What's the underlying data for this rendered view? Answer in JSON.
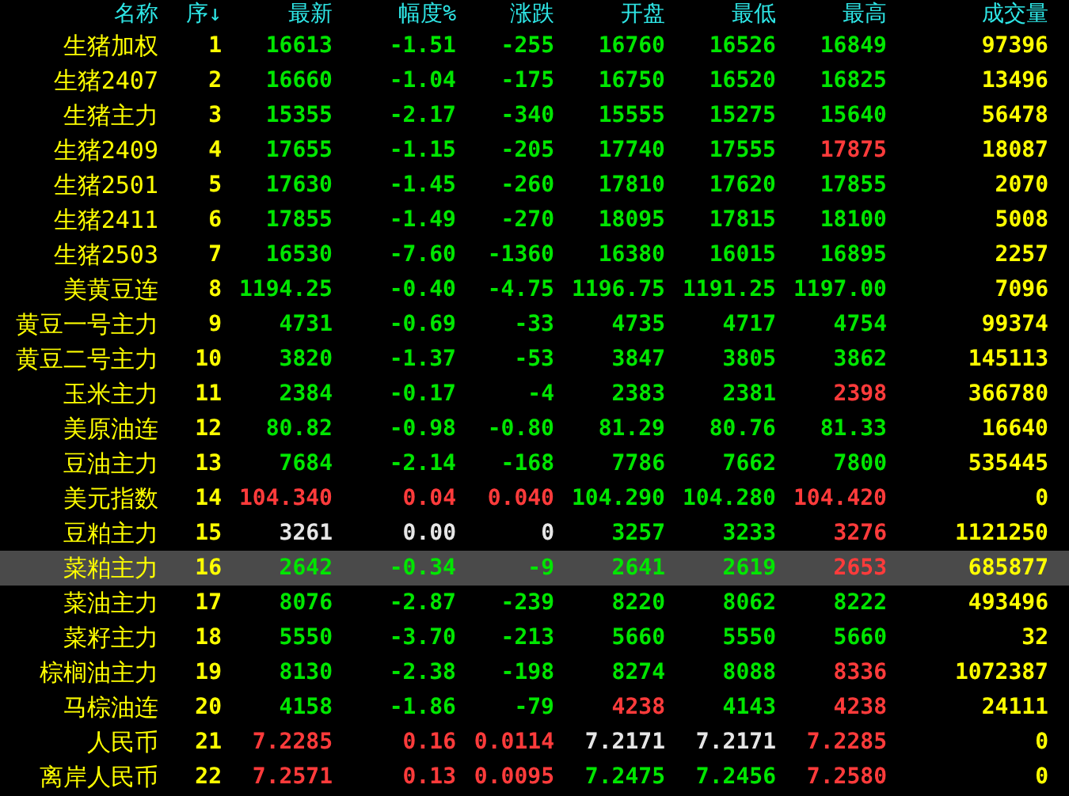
{
  "columns": [
    "名称",
    "序↓",
    "最新",
    "幅度%",
    "涨跌",
    "开盘",
    "最低",
    "最高",
    "成交量"
  ],
  "rows": [
    {
      "name": "生猪加权",
      "index": "1",
      "selected": false,
      "cells": [
        {
          "text": "16613",
          "color": "#00e600"
        },
        {
          "text": "-1.51",
          "color": "#00e600"
        },
        {
          "text": "-255",
          "color": "#00e600"
        },
        {
          "text": "16760",
          "color": "#00e600"
        },
        {
          "text": "16526",
          "color": "#00e600"
        },
        {
          "text": "16849",
          "color": "#00e600"
        }
      ],
      "volume": "97396"
    },
    {
      "name": "生猪2407",
      "index": "2",
      "selected": false,
      "cells": [
        {
          "text": "16660",
          "color": "#00e600"
        },
        {
          "text": "-1.04",
          "color": "#00e600"
        },
        {
          "text": "-175",
          "color": "#00e600"
        },
        {
          "text": "16750",
          "color": "#00e600"
        },
        {
          "text": "16520",
          "color": "#00e600"
        },
        {
          "text": "16825",
          "color": "#00e600"
        }
      ],
      "volume": "13496"
    },
    {
      "name": "生猪主力",
      "index": "3",
      "selected": false,
      "cells": [
        {
          "text": "15355",
          "color": "#00e600"
        },
        {
          "text": "-2.17",
          "color": "#00e600"
        },
        {
          "text": "-340",
          "color": "#00e600"
        },
        {
          "text": "15555",
          "color": "#00e600"
        },
        {
          "text": "15275",
          "color": "#00e600"
        },
        {
          "text": "15640",
          "color": "#00e600"
        }
      ],
      "volume": "56478"
    },
    {
      "name": "生猪2409",
      "index": "4",
      "selected": false,
      "cells": [
        {
          "text": "17655",
          "color": "#00e600"
        },
        {
          "text": "-1.15",
          "color": "#00e600"
        },
        {
          "text": "-205",
          "color": "#00e600"
        },
        {
          "text": "17740",
          "color": "#00e600"
        },
        {
          "text": "17555",
          "color": "#00e600"
        },
        {
          "text": "17875",
          "color": "#ff3b3b"
        }
      ],
      "volume": "18087"
    },
    {
      "name": "生猪2501",
      "index": "5",
      "selected": false,
      "cells": [
        {
          "text": "17630",
          "color": "#00e600"
        },
        {
          "text": "-1.45",
          "color": "#00e600"
        },
        {
          "text": "-260",
          "color": "#00e600"
        },
        {
          "text": "17810",
          "color": "#00e600"
        },
        {
          "text": "17620",
          "color": "#00e600"
        },
        {
          "text": "17855",
          "color": "#00e600"
        }
      ],
      "volume": "2070"
    },
    {
      "name": "生猪2411",
      "index": "6",
      "selected": false,
      "cells": [
        {
          "text": "17855",
          "color": "#00e600"
        },
        {
          "text": "-1.49",
          "color": "#00e600"
        },
        {
          "text": "-270",
          "color": "#00e600"
        },
        {
          "text": "18095",
          "color": "#00e600"
        },
        {
          "text": "17815",
          "color": "#00e600"
        },
        {
          "text": "18100",
          "color": "#00e600"
        }
      ],
      "volume": "5008"
    },
    {
      "name": "生猪2503",
      "index": "7",
      "selected": false,
      "cells": [
        {
          "text": "16530",
          "color": "#00e600"
        },
        {
          "text": "-7.60",
          "color": "#00e600"
        },
        {
          "text": "-1360",
          "color": "#00e600"
        },
        {
          "text": "16380",
          "color": "#00e600"
        },
        {
          "text": "16015",
          "color": "#00e600"
        },
        {
          "text": "16895",
          "color": "#00e600"
        }
      ],
      "volume": "2257"
    },
    {
      "name": "美黄豆连",
      "index": "8",
      "selected": false,
      "cells": [
        {
          "text": "1194.25",
          "color": "#00e600"
        },
        {
          "text": "-0.40",
          "color": "#00e600"
        },
        {
          "text": "-4.75",
          "color": "#00e600"
        },
        {
          "text": "1196.75",
          "color": "#00e600"
        },
        {
          "text": "1191.25",
          "color": "#00e600"
        },
        {
          "text": "1197.00",
          "color": "#00e600"
        }
      ],
      "volume": "7096"
    },
    {
      "name": "黄豆一号主力",
      "index": "9",
      "selected": false,
      "cells": [
        {
          "text": "4731",
          "color": "#00e600"
        },
        {
          "text": "-0.69",
          "color": "#00e600"
        },
        {
          "text": "-33",
          "color": "#00e600"
        },
        {
          "text": "4735",
          "color": "#00e600"
        },
        {
          "text": "4717",
          "color": "#00e600"
        },
        {
          "text": "4754",
          "color": "#00e600"
        }
      ],
      "volume": "99374"
    },
    {
      "name": "黄豆二号主力",
      "index": "10",
      "selected": false,
      "cells": [
        {
          "text": "3820",
          "color": "#00e600"
        },
        {
          "text": "-1.37",
          "color": "#00e600"
        },
        {
          "text": "-53",
          "color": "#00e600"
        },
        {
          "text": "3847",
          "color": "#00e600"
        },
        {
          "text": "3805",
          "color": "#00e600"
        },
        {
          "text": "3862",
          "color": "#00e600"
        }
      ],
      "volume": "145113"
    },
    {
      "name": "玉米主力",
      "index": "11",
      "selected": false,
      "cells": [
        {
          "text": "2384",
          "color": "#00e600"
        },
        {
          "text": "-0.17",
          "color": "#00e600"
        },
        {
          "text": "-4",
          "color": "#00e600"
        },
        {
          "text": "2383",
          "color": "#00e600"
        },
        {
          "text": "2381",
          "color": "#00e600"
        },
        {
          "text": "2398",
          "color": "#ff3b3b"
        }
      ],
      "volume": "366780"
    },
    {
      "name": "美原油连",
      "index": "12",
      "selected": false,
      "cells": [
        {
          "text": "80.82",
          "color": "#00e600"
        },
        {
          "text": "-0.98",
          "color": "#00e600"
        },
        {
          "text": "-0.80",
          "color": "#00e600"
        },
        {
          "text": "81.29",
          "color": "#00e600"
        },
        {
          "text": "80.76",
          "color": "#00e600"
        },
        {
          "text": "81.33",
          "color": "#00e600"
        }
      ],
      "volume": "16640"
    },
    {
      "name": "豆油主力",
      "index": "13",
      "selected": false,
      "cells": [
        {
          "text": "7684",
          "color": "#00e600"
        },
        {
          "text": "-2.14",
          "color": "#00e600"
        },
        {
          "text": "-168",
          "color": "#00e600"
        },
        {
          "text": "7786",
          "color": "#00e600"
        },
        {
          "text": "7662",
          "color": "#00e600"
        },
        {
          "text": "7800",
          "color": "#00e600"
        }
      ],
      "volume": "535445"
    },
    {
      "name": "美元指数",
      "index": "14",
      "selected": false,
      "cells": [
        {
          "text": "104.340",
          "color": "#ff3b3b"
        },
        {
          "text": "0.04",
          "color": "#ff3b3b"
        },
        {
          "text": "0.040",
          "color": "#ff3b3b"
        },
        {
          "text": "104.290",
          "color": "#00e600"
        },
        {
          "text": "104.280",
          "color": "#00e600"
        },
        {
          "text": "104.420",
          "color": "#ff3b3b"
        }
      ],
      "volume": "0"
    },
    {
      "name": "豆粕主力",
      "index": "15",
      "selected": false,
      "cells": [
        {
          "text": "3261",
          "color": "#e6e6e6"
        },
        {
          "text": "0.00",
          "color": "#e6e6e6"
        },
        {
          "text": "0",
          "color": "#e6e6e6"
        },
        {
          "text": "3257",
          "color": "#00e600"
        },
        {
          "text": "3233",
          "color": "#00e600"
        },
        {
          "text": "3276",
          "color": "#ff3b3b"
        }
      ],
      "volume": "1121250"
    },
    {
      "name": "菜粕主力",
      "index": "16",
      "selected": true,
      "cells": [
        {
          "text": "2642",
          "color": "#00e600"
        },
        {
          "text": "-0.34",
          "color": "#00e600"
        },
        {
          "text": "-9",
          "color": "#00e600"
        },
        {
          "text": "2641",
          "color": "#00e600"
        },
        {
          "text": "2619",
          "color": "#00e600"
        },
        {
          "text": "2653",
          "color": "#ff3b3b"
        }
      ],
      "volume": "685877"
    },
    {
      "name": "菜油主力",
      "index": "17",
      "selected": false,
      "cells": [
        {
          "text": "8076",
          "color": "#00e600"
        },
        {
          "text": "-2.87",
          "color": "#00e600"
        },
        {
          "text": "-239",
          "color": "#00e600"
        },
        {
          "text": "8220",
          "color": "#00e600"
        },
        {
          "text": "8062",
          "color": "#00e600"
        },
        {
          "text": "8222",
          "color": "#00e600"
        }
      ],
      "volume": "493496"
    },
    {
      "name": "菜籽主力",
      "index": "18",
      "selected": false,
      "cells": [
        {
          "text": "5550",
          "color": "#00e600"
        },
        {
          "text": "-3.70",
          "color": "#00e600"
        },
        {
          "text": "-213",
          "color": "#00e600"
        },
        {
          "text": "5660",
          "color": "#00e600"
        },
        {
          "text": "5550",
          "color": "#00e600"
        },
        {
          "text": "5660",
          "color": "#00e600"
        }
      ],
      "volume": "32"
    },
    {
      "name": "棕榈油主力",
      "index": "19",
      "selected": false,
      "cells": [
        {
          "text": "8130",
          "color": "#00e600"
        },
        {
          "text": "-2.38",
          "color": "#00e600"
        },
        {
          "text": "-198",
          "color": "#00e600"
        },
        {
          "text": "8274",
          "color": "#00e600"
        },
        {
          "text": "8088",
          "color": "#00e600"
        },
        {
          "text": "8336",
          "color": "#ff3b3b"
        }
      ],
      "volume": "1072387"
    },
    {
      "name": "马棕油连",
      "index": "20",
      "selected": false,
      "cells": [
        {
          "text": "4158",
          "color": "#00e600"
        },
        {
          "text": "-1.86",
          "color": "#00e600"
        },
        {
          "text": "-79",
          "color": "#00e600"
        },
        {
          "text": "4238",
          "color": "#ff3b3b"
        },
        {
          "text": "4143",
          "color": "#00e600"
        },
        {
          "text": "4238",
          "color": "#ff3b3b"
        }
      ],
      "volume": "24111"
    },
    {
      "name": "人民币",
      "index": "21",
      "selected": false,
      "cells": [
        {
          "text": "7.2285",
          "color": "#ff3b3b"
        },
        {
          "text": "0.16",
          "color": "#ff3b3b"
        },
        {
          "text": "0.0114",
          "color": "#ff3b3b"
        },
        {
          "text": "7.2171",
          "color": "#e6e6e6"
        },
        {
          "text": "7.2171",
          "color": "#e6e6e6"
        },
        {
          "text": "7.2285",
          "color": "#ff3b3b"
        }
      ],
      "volume": "0"
    },
    {
      "name": "离岸人民币",
      "index": "22",
      "selected": false,
      "cells": [
        {
          "text": "7.2571",
          "color": "#ff3b3b"
        },
        {
          "text": "0.13",
          "color": "#ff3b3b"
        },
        {
          "text": "0.0095",
          "color": "#ff3b3b"
        },
        {
          "text": "7.2475",
          "color": "#00e600"
        },
        {
          "text": "7.2456",
          "color": "#00e600"
        },
        {
          "text": "7.2580",
          "color": "#ff3b3b"
        }
      ],
      "volume": "0"
    }
  ]
}
